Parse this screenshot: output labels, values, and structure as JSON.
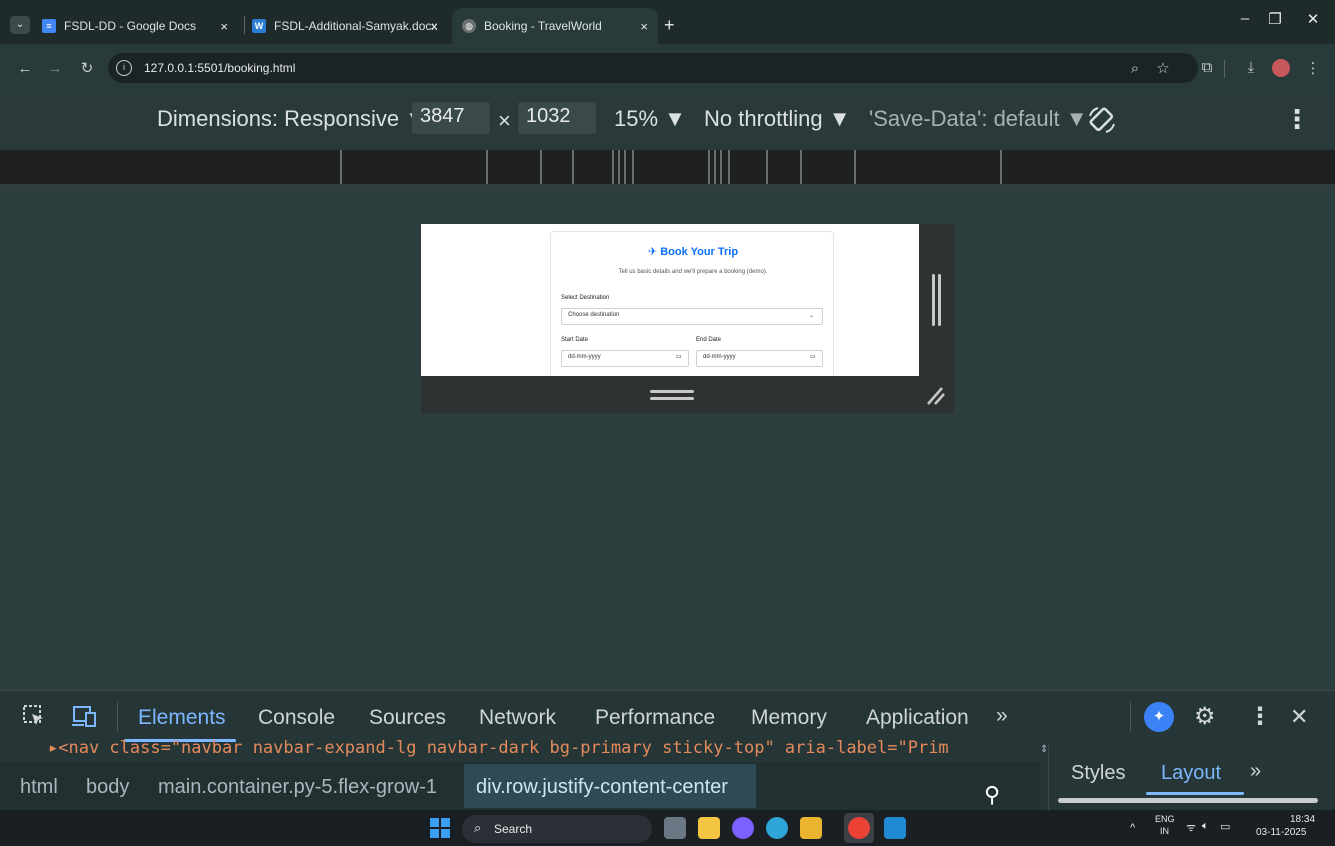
{
  "tabs": [
    {
      "title": "FSDL-DD - Google Docs",
      "icon": "google-docs-icon",
      "color": "#4285f4"
    },
    {
      "title": "FSDL-Additional-Samyak.docx",
      "icon": "word-doc-icon",
      "color": "#2b7cd3"
    },
    {
      "title": "Booking - TravelWorld",
      "icon": "globe-icon",
      "color": "#9aa0a6"
    }
  ],
  "close_glyph": "×",
  "new_tab_glyph": "+",
  "address": {
    "url": "127.0.0.1:5501/booking.html"
  },
  "device_toolbar": {
    "dimensions_label": "Dimensions: Responsive ▼",
    "width": "3847",
    "times": "×",
    "height": "1032",
    "zoom": "15% ▼",
    "throttling": "No throttling ▼",
    "save_data": "'Save-Data': default ▼"
  },
  "booking_page": {
    "title": "Book Your Trip",
    "subtitle": "Tell us basic details and we'll prepare a booking (demo).",
    "destination_label": "Select Destination",
    "destination_value": "Choose destination",
    "start_label": "Start Date",
    "end_label": "End Date",
    "date_placeholder": "dd-mm-yyyy"
  },
  "devtools": {
    "tabs": [
      "Elements",
      "Console",
      "Sources",
      "Network",
      "Performance",
      "Memory",
      "Application"
    ],
    "more": "»",
    "dom_line": "▸<nav class=\"navbar navbar-expand-lg navbar-dark bg-primary sticky-top\" aria-label=\"Prim",
    "breadcrumbs": [
      "html",
      "body",
      "main.container.py-5.flex-grow-1",
      "div.row.justify-content-center"
    ],
    "side_tabs": [
      "Styles",
      "Layout"
    ],
    "accent": "#7cb7ff"
  },
  "taskbar": {
    "search": "Search",
    "lang_top": "ENG",
    "lang_bottom": "IN",
    "time": "18:34",
    "date": "03-11-2025"
  }
}
